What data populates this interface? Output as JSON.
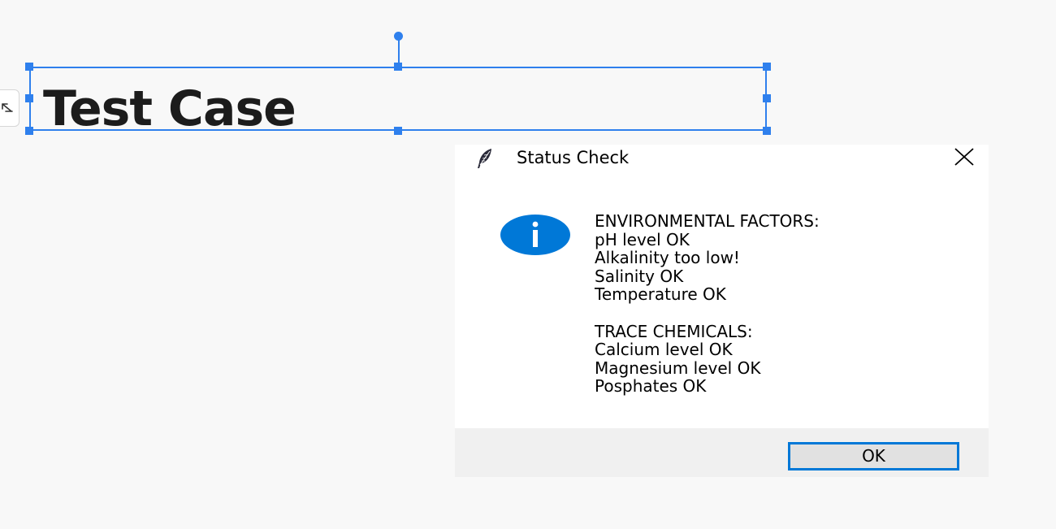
{
  "canvas": {
    "heading_text": "Test Case"
  },
  "dialog": {
    "title": "Status Check",
    "icon": "info-icon",
    "icon_color": "#0078d7",
    "message": {
      "environmental_header": "ENVIRONMENTAL FACTORS:",
      "environmental_items": [
        "pH level OK",
        "Alkalinity too low!",
        "Salinity OK",
        "Temperature OK"
      ],
      "trace_header": "TRACE CHEMICALS:",
      "trace_items": [
        "Calcium level OK",
        "Magnesium level OK",
        "Posphates OK"
      ]
    },
    "ok_label": "OK"
  },
  "colors": {
    "selection": "#2f80ed",
    "ok_focus_border": "#0078d7",
    "footer_bg": "#f0f0f0"
  }
}
